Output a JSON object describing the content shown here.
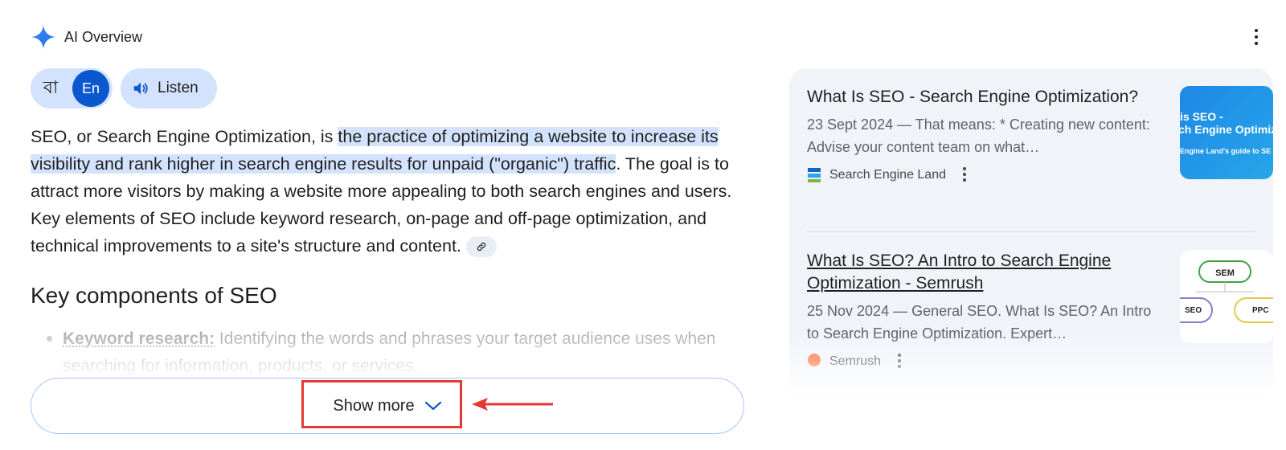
{
  "header": {
    "title": "AI Overview",
    "icon": "sparkle-icon",
    "menu_icon": "more-vert-icon"
  },
  "language": {
    "bn_label": "বা",
    "en_label": "En",
    "selected": "En"
  },
  "listen": {
    "label": "Listen",
    "icon": "speaker-icon"
  },
  "overview": {
    "text_before": "SEO, or Search Engine Optimization, is ",
    "highlight": "the practice of optimizing a website to increase its visibility and rank higher in search engine results for unpaid (\"organic\") traffic",
    "text_after": ". The goal is to attract more visitors by making a website more appealing to both search engines and users. Key elements of SEO include keyword research, on-page and off-page optimization, and technical improvements to a site's structure and content.",
    "link_icon": "link-icon"
  },
  "section": {
    "heading": "Key components of SEO",
    "bullets": [
      {
        "keyword": "Keyword research:",
        "text": " Identifying the words and phrases your target audience uses when searching for information, products, or services."
      }
    ]
  },
  "show_more": {
    "label": "Show more",
    "icon": "chevron-down-icon"
  },
  "annotation": {
    "color": "#e53935"
  },
  "sources": [
    {
      "title": "What Is SEO - Search Engine Optimization?",
      "snippet": "23 Sept 2024 — That means: * Creating new content: Advise your content team on what…",
      "site": "Search Engine Land",
      "favicon_text": "Search Engine Land",
      "thumb_lines": [
        "is SEO -",
        "ch Engine Optimizati",
        "Engine Land's guide to SE"
      ]
    },
    {
      "title": "What Is SEO? An Intro to Search Engine Optimization - Semrush",
      "snippet": "25 Nov 2024 — General SEO. What Is SEO? An Intro to Search Engine Optimization. Expert…",
      "site": "Semrush",
      "thumb_labels": [
        "SEM",
        "SEO",
        "PPC"
      ]
    }
  ],
  "colors": {
    "accent": "#0b57d0",
    "chip": "#d3e3fd",
    "panel": "#f0f4f9",
    "text": "#1f1f1f"
  }
}
